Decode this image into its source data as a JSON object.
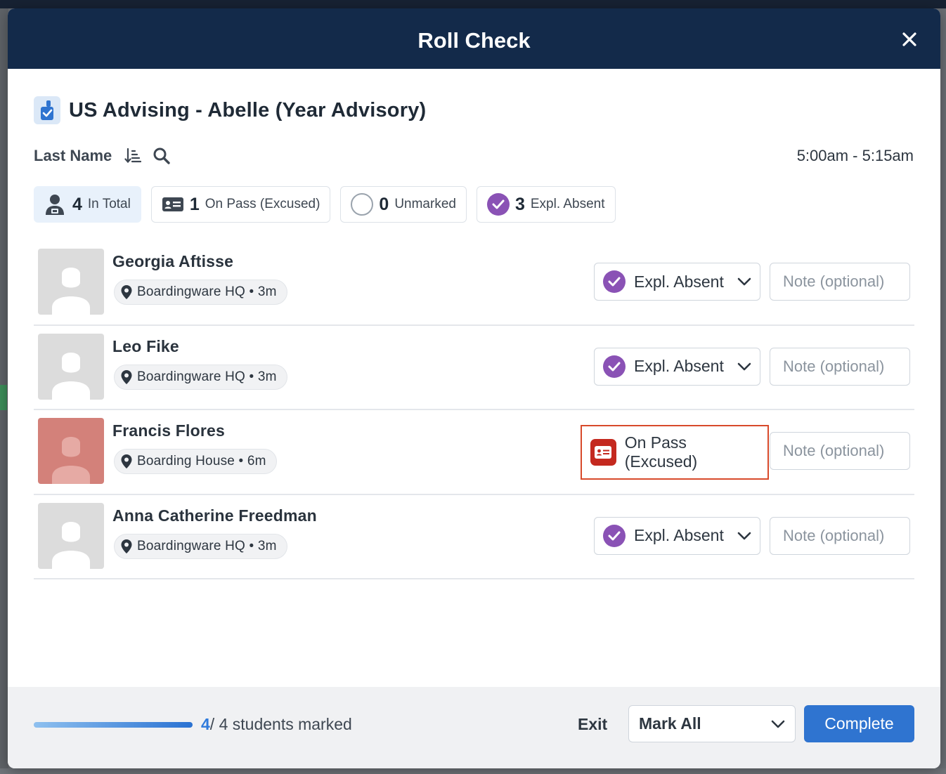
{
  "modal": {
    "title": "Roll Check",
    "close_label": "×"
  },
  "class": {
    "title": "US Advising - Abelle (Year Advisory)",
    "icon": "roll-check-icon"
  },
  "toolbar": {
    "sort_label": "Last Name",
    "sort_icon": "sort-ascending-icon",
    "search_icon": "search-icon",
    "time_range": "5:00am - 5:15am"
  },
  "summary": [
    {
      "count": "4",
      "label": "In Total",
      "icon": "student-icon"
    },
    {
      "count": "1",
      "label": "On Pass (Excused)",
      "icon": "pass-card-icon"
    },
    {
      "count": "0",
      "label": "Unmarked",
      "icon": "empty-circle-icon"
    },
    {
      "count": "3",
      "label": "Expl. Absent",
      "icon": "check-circle-icon"
    }
  ],
  "students": [
    {
      "name": "Georgia Aftisse",
      "location": "Boardingware HQ • 3m",
      "status": "Expl. Absent",
      "note_placeholder": "Note (optional)"
    },
    {
      "name": "Leo Fike",
      "location": "Boardingware HQ • 3m",
      "status": "Expl. Absent",
      "note_placeholder": "Note (optional)"
    },
    {
      "name": "Francis Flores",
      "location": "Boarding House • 6m",
      "status": "On Pass (Excused)",
      "note_placeholder": "Note (optional)"
    },
    {
      "name": "Anna Catherine Freedman",
      "location": "Boardingware HQ • 3m",
      "status": "Expl. Absent",
      "note_placeholder": "Note (optional)"
    }
  ],
  "footer": {
    "progress_done": "4",
    "progress_rest": "/ 4 students marked",
    "progress_fraction": 1.0,
    "exit_label": "Exit",
    "mark_all_label": "Mark All",
    "complete_label": "Complete"
  },
  "colors": {
    "header": "#132a4a",
    "accent_blue": "#2f74d0",
    "absent_purple": "#8a52b5",
    "pass_red": "#c4291f",
    "highlight_border": "#d84a2b"
  }
}
